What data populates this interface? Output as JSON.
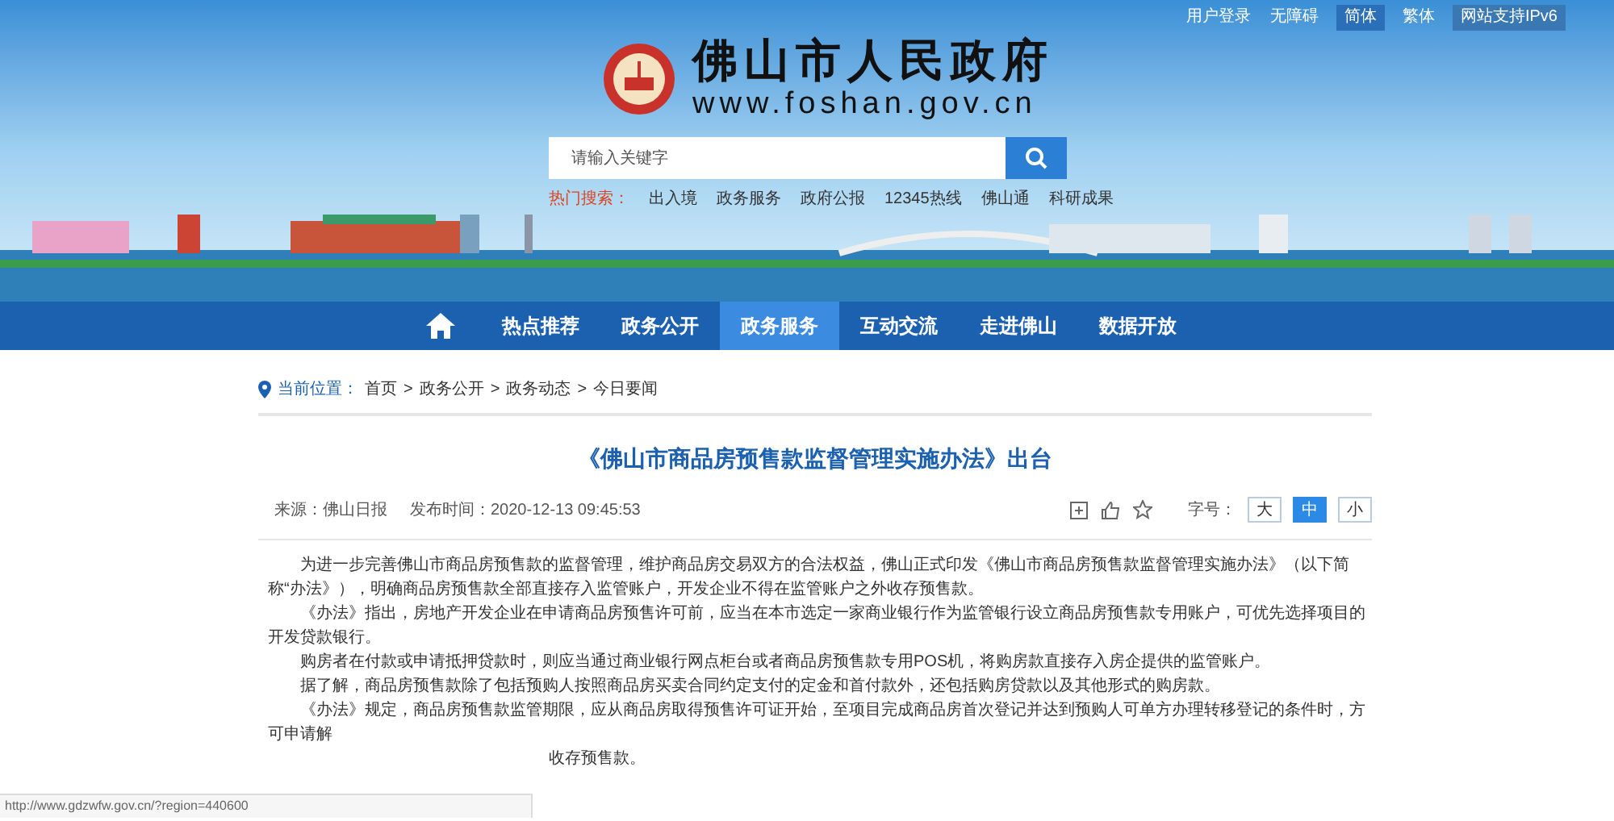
{
  "top_links": [
    {
      "label": "用户登录",
      "selected": false
    },
    {
      "label": "无障碍",
      "selected": false
    },
    {
      "label": "简体",
      "selected": true
    },
    {
      "label": "繁体",
      "selected": false
    },
    {
      "label": "网站支持IPv6",
      "selected": false,
      "kind": "badge"
    }
  ],
  "site": {
    "title": "佛山市人民政府",
    "url": "www.foshan.gov.cn"
  },
  "search": {
    "placeholder": "请输入关键字",
    "hot_label": "热门搜索：",
    "hot_terms": [
      "出入境",
      "政务服务",
      "政府公报",
      "12345热线",
      "佛山通",
      "科研成果"
    ]
  },
  "nav": [
    {
      "label": "热点推荐",
      "selected": false
    },
    {
      "label": "政务公开",
      "selected": false
    },
    {
      "label": "政务服务",
      "selected": true
    },
    {
      "label": "互动交流",
      "selected": false
    },
    {
      "label": "走进佛山",
      "selected": false
    },
    {
      "label": "数据开放",
      "selected": false
    }
  ],
  "breadcrumb": {
    "label": "当前位置：",
    "items": [
      "首页",
      "政务公开",
      "政务动态",
      "今日要闻"
    ],
    "separator": ">"
  },
  "article": {
    "title": "《佛山市商品房预售款监督管理实施办法》出台",
    "source": "来源：佛山日报",
    "time": "发布时间：2020-12-13 09:45:53",
    "font_size_label": "字号：",
    "font_sizes": [
      {
        "label": "大",
        "selected": false
      },
      {
        "label": "中",
        "selected": true
      },
      {
        "label": "小",
        "selected": false
      }
    ],
    "paragraphs": [
      "为进一步完善佛山市商品房预售款的监督管理，维护商品房交易双方的合法权益，佛山正式印发《佛山市商品房预售款监督管理实施办法》（以下简称“办法》），明确商品房预售款全部直接存入监管账户，开发企业不得在监管账户之外收存预售款。",
      "《办法》指出，房地产开发企业在申请商品房预售许可前，应当在本市选定一家商业银行作为监管银行设立商品房预售款专用账户，可优先选择项目的开发贷款银行。",
      "购房者在付款或申请抵押贷款时，则应当通过商业银行网点柜台或者商品房预售款专用POS机，将购房款直接存入房企提供的监管账户。",
      "据了解，商品房预售款除了包括预购人按照商品房买卖合同约定支付的定金和首付款外，还包括购房贷款以及其他形式的购房款。",
      "《办法》规定，商品房预售款监管期限，应从商品房取得预售许可证开始，至项目完成商品房首次登记并达到预购人可单方办理转移登记的条件时，方可申请解"
    ],
    "cut_line": "收存预售款。"
  },
  "status_url": "http://www.gdzwfw.gov.cn/?region=440600"
}
